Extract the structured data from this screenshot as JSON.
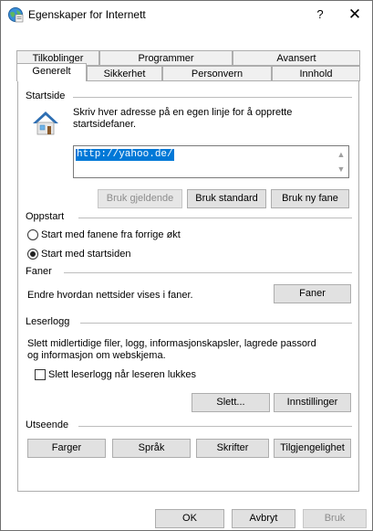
{
  "window": {
    "title": "Egenskaper for Internett",
    "help_glyph": "?",
    "close_glyph": "✕"
  },
  "tabs": {
    "row_top": [
      "Tilkoblinger",
      "Programmer",
      "Avansert"
    ],
    "row_bottom": [
      "Generelt",
      "Sikkerhet",
      "Personvern",
      "Innhold"
    ],
    "active": "Generelt"
  },
  "startside": {
    "heading": "Startside",
    "description_line1": "Skriv hver adresse på en egen linje for å opprette",
    "description_line2": "startsidefaner.",
    "url_value": "http://yahoo.de/",
    "btn_current": "Bruk gjeldende",
    "btn_default": "Bruk standard",
    "btn_new_tab": "Bruk ny fane"
  },
  "oppstart": {
    "heading": "Oppstart",
    "option_previous": "Start med fanene fra forrige økt",
    "option_home": "Start med startsiden",
    "selected": "option_home"
  },
  "faner": {
    "heading": "Faner",
    "description": "Endre hvordan nettsider vises i faner.",
    "btn": "Faner"
  },
  "leserlogg": {
    "heading": "Leserlogg",
    "description_line1": "Slett midlertidige filer, logg, informasjonskapsler, lagrede passord",
    "description_line2": "og informasjon om webskjema.",
    "checkbox_label": "Slett leserlogg når leseren lukkes",
    "checkbox_checked": false,
    "btn_delete": "Slett...",
    "btn_settings": "Innstillinger"
  },
  "utseende": {
    "heading": "Utseende",
    "btn_colors": "Farger",
    "btn_languages": "Språk",
    "btn_fonts": "Skrifter",
    "btn_accessibility": "Tilgjengelighet"
  },
  "footer": {
    "ok": "OK",
    "cancel": "Avbryt",
    "apply": "Bruk"
  },
  "colors": {
    "accent": "#0078d7",
    "disabled_text": "#8d8d8d"
  }
}
